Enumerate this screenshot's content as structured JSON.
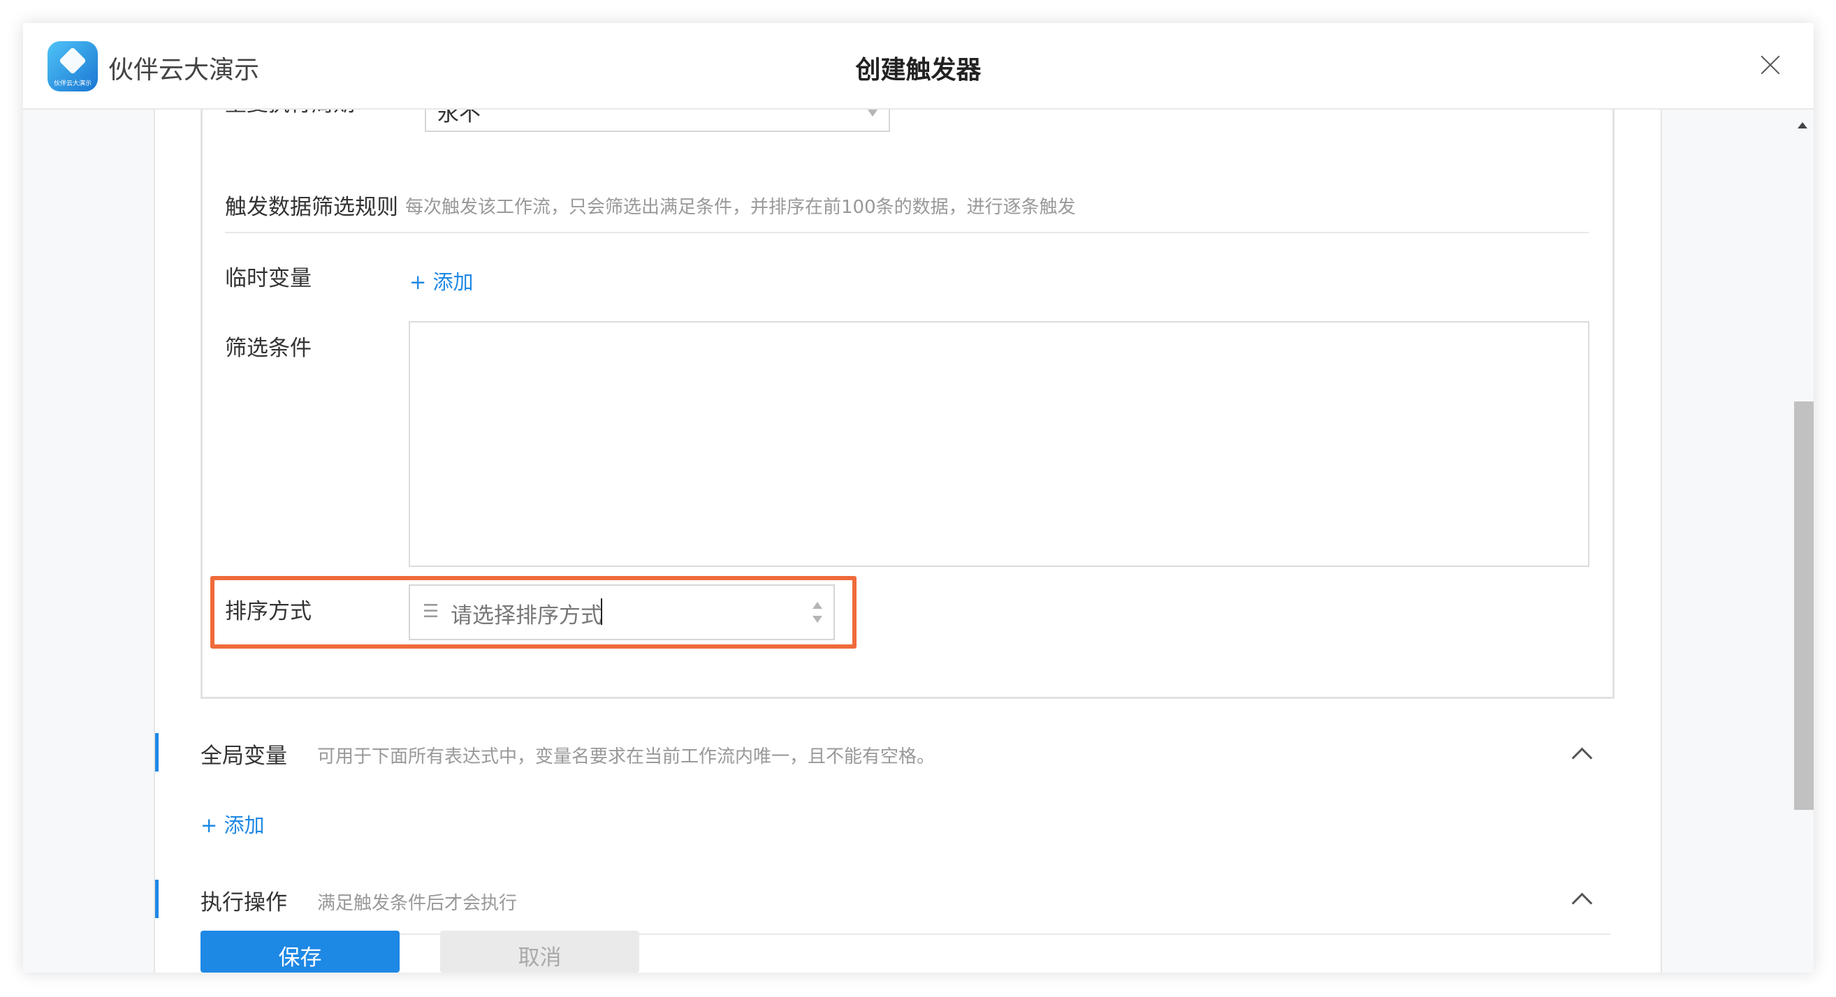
{
  "app": {
    "name": "伙伴云大演示",
    "logo_text": "伙伴云大演示",
    "dialog_title": "创建触发器"
  },
  "form": {
    "repeat_period": {
      "label": "重复执行周期",
      "value": "永不"
    },
    "filter_rule": {
      "label": "触发数据筛选规则",
      "description": "每次触发该工作流，只会筛选出满足条件，并排序在前100条的数据，进行逐条触发"
    },
    "temp_var": {
      "label": "临时变量",
      "add_label": "+ 添加"
    },
    "condition": {
      "label": "筛选条件"
    },
    "sort": {
      "label": "排序方式",
      "placeholder": "请选择排序方式",
      "icon": "sort-icon"
    }
  },
  "global_vars": {
    "title": "全局变量",
    "description": "可用于下面所有表达式中，变量名要求在当前工作流内唯一，且不能有空格。",
    "add_label": "+ 添加"
  },
  "actions": {
    "title": "执行操作",
    "description": "满足触发条件后才会执行"
  },
  "buttons": {
    "save": "保存",
    "cancel": "取消"
  },
  "colors": {
    "accent": "#1e88e5",
    "highlight": "#ef6a3a"
  }
}
